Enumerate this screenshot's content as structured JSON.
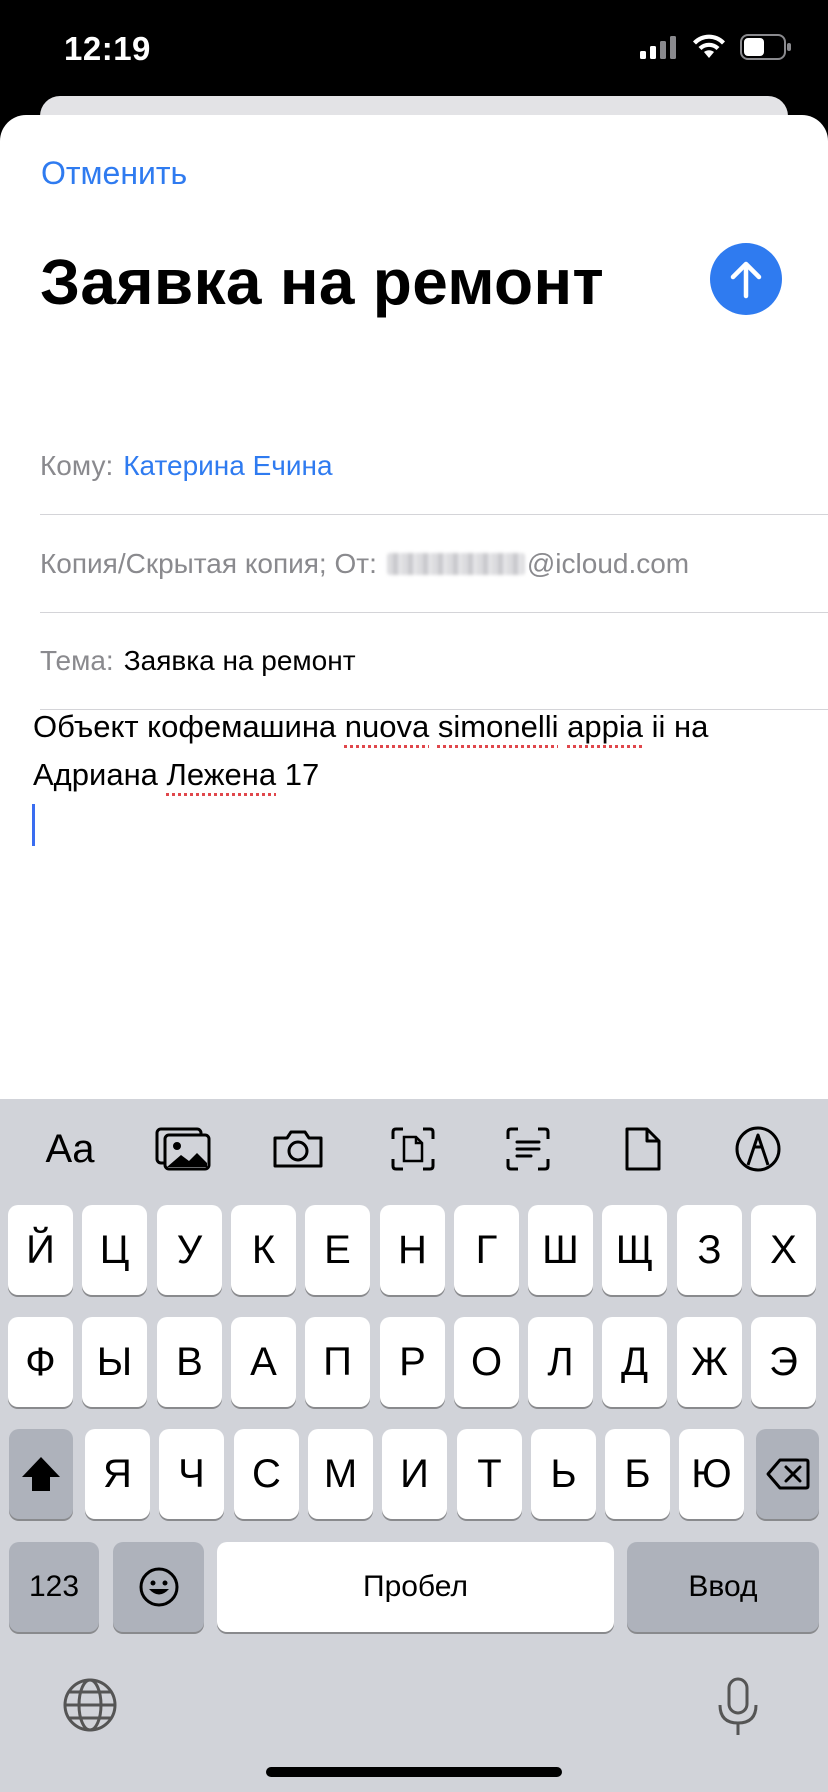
{
  "status_bar": {
    "time": "12:19"
  },
  "compose": {
    "cancel_label": "Отменить",
    "title": "Заявка на ремонт",
    "to_label": "Кому:",
    "to_value": "Катерина Ечина",
    "cc_label": "Копия/Скрытая копия; От:",
    "from_email_suffix": "@icloud.com",
    "subject_label": "Тема:",
    "subject_value": "Заявка на ремонт",
    "body": {
      "line1_a": "Объект кофемашина ",
      "line1_b": "nuova",
      "line1_c": " ",
      "line1_d": "simonelli",
      "line1_e": " ",
      "line1_f": "appia",
      "line1_g": " ii на",
      "line2_a": "Адриана ",
      "line2_b": "Лежена",
      "line2_c": " 17"
    }
  },
  "keyboard": {
    "toolbar_aa": "Aa",
    "row1": [
      "Й",
      "Ц",
      "У",
      "К",
      "Е",
      "Н",
      "Г",
      "Ш",
      "Щ",
      "З",
      "Х"
    ],
    "row2": [
      "Ф",
      "Ы",
      "В",
      "А",
      "П",
      "Р",
      "О",
      "Л",
      "Д",
      "Ж",
      "Э"
    ],
    "row3": [
      "Я",
      "Ч",
      "С",
      "М",
      "И",
      "Т",
      "Ь",
      "Б",
      "Ю"
    ],
    "numbers_label": "123",
    "space_label": "Пробел",
    "return_label": "Ввод"
  },
  "colors": {
    "accent": "#2f7bf0",
    "keyboard_bg": "#d1d3d9",
    "dark_key": "#aeb2bb"
  }
}
